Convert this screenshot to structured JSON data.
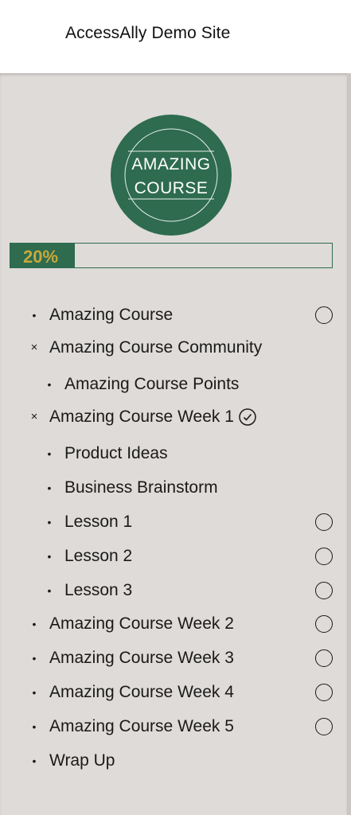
{
  "header": {
    "site_title": "AccessAlly Demo Site"
  },
  "logo": {
    "line1": "AMAZING",
    "line2": "COURSE"
  },
  "progress": {
    "label": "20%",
    "fraction": 0.2
  },
  "colors": {
    "brand_green": "#2e6b4f",
    "progress_text": "#c8a83c",
    "sidebar_bg": "#dedbd8"
  },
  "menu": [
    {
      "label": "Amazing Course",
      "marker": "•",
      "status_icon": "circle-icon"
    },
    {
      "label": "Amazing Course Community",
      "marker": "×",
      "status_icon": ""
    },
    {
      "label": "Amazing Course Points",
      "marker": "•",
      "status_icon": ""
    },
    {
      "label": "Amazing Course Week 1",
      "marker": "×",
      "status_icon": "check-circle-icon"
    },
    {
      "label": "Product Ideas",
      "marker": "•",
      "status_icon": ""
    },
    {
      "label": "Business Brainstorm",
      "marker": "•",
      "status_icon": ""
    },
    {
      "label": "Lesson 1",
      "marker": "•",
      "status_icon": "circle-icon"
    },
    {
      "label": "Lesson 2",
      "marker": "•",
      "status_icon": "circle-icon"
    },
    {
      "label": "Lesson 3",
      "marker": "•",
      "status_icon": "circle-icon"
    },
    {
      "label": "Amazing Course Week 2",
      "marker": "•",
      "status_icon": "circle-icon"
    },
    {
      "label": "Amazing Course Week 3",
      "marker": "•",
      "status_icon": "circle-icon"
    },
    {
      "label": "Amazing Course Week 4",
      "marker": "•",
      "status_icon": "circle-icon"
    },
    {
      "label": "Amazing Course Week 5",
      "marker": "•",
      "status_icon": "circle-icon"
    },
    {
      "label": "Wrap Up",
      "marker": "•",
      "status_icon": ""
    }
  ]
}
